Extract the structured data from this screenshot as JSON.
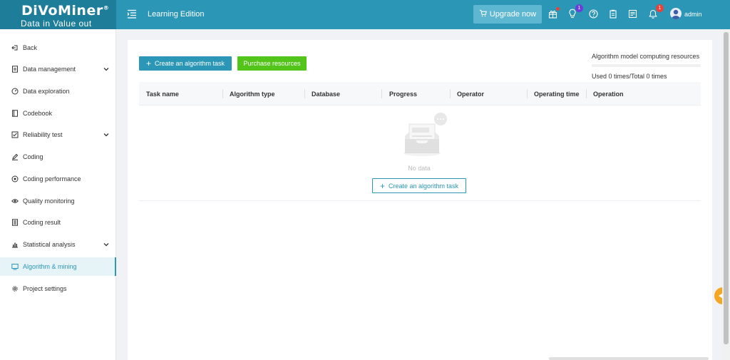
{
  "header": {
    "logo_text": "DiVoMiner",
    "logo_trademark": "®",
    "logo_tagline": "Data in  Value out",
    "edition": "Learning Edition",
    "upgrade_label": "Upgrade now",
    "tips_badge": "1",
    "notification_badge": "1",
    "username": "admin"
  },
  "sidebar": {
    "items": [
      {
        "label": "Back",
        "icon": "back-icon"
      },
      {
        "label": "Data management",
        "icon": "document-icon",
        "expandable": true
      },
      {
        "label": "Data exploration",
        "icon": "dashboard-icon"
      },
      {
        "label": "Codebook",
        "icon": "book-icon"
      },
      {
        "label": "Reliability test",
        "icon": "checklist-icon",
        "expandable": true
      },
      {
        "label": "Coding",
        "icon": "pen-icon"
      },
      {
        "label": "Coding performance",
        "icon": "gauge-icon"
      },
      {
        "label": "Quality monitoring",
        "icon": "eye-icon"
      },
      {
        "label": "Coding result",
        "icon": "list-icon"
      },
      {
        "label": "Statistical analysis",
        "icon": "bar-chart-icon",
        "expandable": true
      },
      {
        "label": "Algorithm & mining",
        "icon": "monitor-icon",
        "active": true
      },
      {
        "label": "Project settings",
        "icon": "gear-icon"
      }
    ]
  },
  "toolbar": {
    "create_label": "Create an algorithm task",
    "purchase_label": "Purchase resources"
  },
  "resources": {
    "title": "Algorithm model computing resources",
    "usage_text": "Used 0 times/Total 0 times",
    "usage_fraction": 0
  },
  "table": {
    "columns": [
      "Task name",
      "Algorithm type",
      "Database",
      "Progress",
      "Operator",
      "Operating time",
      "Operation"
    ],
    "rows": []
  },
  "empty": {
    "text": "No data",
    "create_label": "Create an algorithm task"
  },
  "colors": {
    "primary": "#2b96b5",
    "purchase": "#52c41a",
    "handle": "#f5a623"
  }
}
